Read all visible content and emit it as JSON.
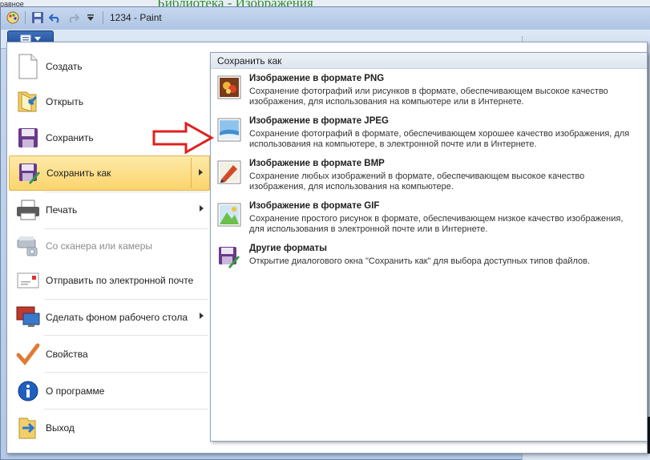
{
  "background": {
    "title": "Библиотека - Изображения",
    "corner_text": "равное"
  },
  "window": {
    "title": "1234 - Paint"
  },
  "file_menu": {
    "items": [
      {
        "label": "Создать",
        "icon": "new-file-icon"
      },
      {
        "label": "Открыть",
        "icon": "open-folder-icon"
      },
      {
        "label": "Сохранить",
        "icon": "save-disk-icon"
      },
      {
        "label": "Сохранить как",
        "icon": "save-as-icon",
        "has_submenu": true,
        "active": true
      },
      {
        "label": "Печать",
        "icon": "printer-icon",
        "has_submenu": true
      },
      {
        "label": "Со сканера или камеры",
        "icon": "scanner-icon",
        "disabled": true
      },
      {
        "label": "Отправить по электронной почте",
        "icon": "email-icon"
      },
      {
        "label": "Сделать фоном рабочего стола",
        "icon": "desktop-icon",
        "has_submenu": true
      },
      {
        "label": "Свойства",
        "icon": "checkmark-icon"
      },
      {
        "label": "О программе",
        "icon": "info-icon"
      },
      {
        "label": "Выход",
        "icon": "exit-icon"
      }
    ]
  },
  "save_as_panel": {
    "header": "Сохранить как",
    "items": [
      {
        "title": "Изображение в формате PNG",
        "description": "Сохранение фотографий или рисунков в формате, обеспечивающем высокое качество изображения, для использования на компьютере или в Интернете.",
        "icon": "png-image-icon"
      },
      {
        "title": "Изображение в формате JPEG",
        "description": "Сохранение фотографий в формате, обеспечивающем хорошее качество изображения, для использования на компьютере, в электронной почте или в Интернете.",
        "icon": "jpeg-image-icon"
      },
      {
        "title": "Изображение в формате BMP",
        "description": "Сохранение любых изображений в формате, обеспечивающем высокое качество изображения, для использования на компьютере.",
        "icon": "bmp-image-icon"
      },
      {
        "title": "Изображение в формате GIF",
        "description": "Сохранение простого рисунок в формате, обеспечивающем низкое качество изображения, для использования в электронной почте или в Интернете.",
        "icon": "gif-image-icon"
      },
      {
        "title": "Другие форматы",
        "description": "Открытие диалогового окна \"Сохранить как\" для выбора доступных типов файлов.",
        "icon": "other-formats-icon"
      }
    ]
  },
  "colors": {
    "highlight": "#fbd46c",
    "arrow": "#e02020"
  }
}
